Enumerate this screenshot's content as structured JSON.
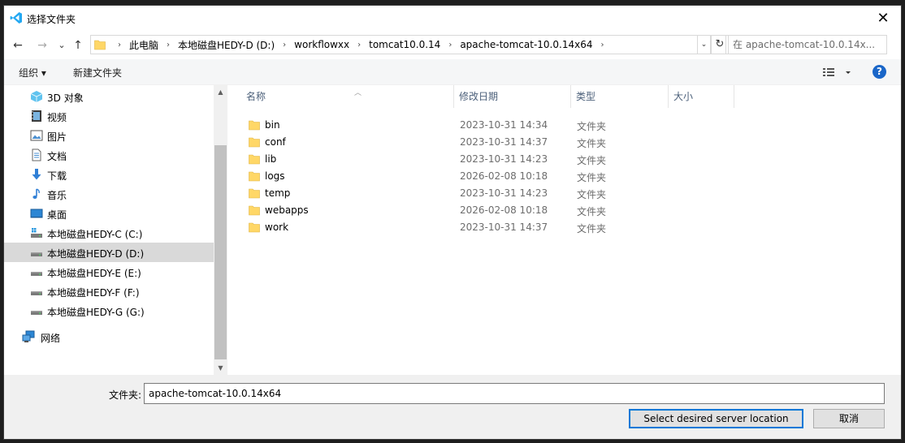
{
  "window": {
    "title": "选择文件夹",
    "close_glyph": "✕"
  },
  "nav": {
    "back": "←",
    "forward": "→",
    "recent": "⌄",
    "up": "↑"
  },
  "address": {
    "crumbs": [
      "此电脑",
      "本地磁盘HEDY-D (D:)",
      "workflowxx",
      "tomcat10.0.14",
      "apache-tomcat-10.0.14x64"
    ],
    "separator": "›",
    "dropdown_glyph": "⌄",
    "refresh_glyph": "↻"
  },
  "search": {
    "placeholder": "在 apache-tomcat-10.0.14x..."
  },
  "commands": {
    "organize": "组织 ▾",
    "new_folder": "新建文件夹",
    "help": "?"
  },
  "sidebar": {
    "items": [
      {
        "label": "3D 对象",
        "icon": "3d-objects-icon"
      },
      {
        "label": "视频",
        "icon": "video-icon"
      },
      {
        "label": "图片",
        "icon": "pictures-icon"
      },
      {
        "label": "文档",
        "icon": "documents-icon"
      },
      {
        "label": "下载",
        "icon": "download-icon"
      },
      {
        "label": "音乐",
        "icon": "music-icon"
      },
      {
        "label": "桌面",
        "icon": "desktop-icon"
      },
      {
        "label": "本地磁盘HEDY-C (C:)",
        "icon": "system-drive-icon"
      },
      {
        "label": "本地磁盘HEDY-D (D:)",
        "icon": "drive-icon",
        "selected": true
      },
      {
        "label": "本地磁盘HEDY-E (E:)",
        "icon": "drive-icon"
      },
      {
        "label": "本地磁盘HEDY-F (F:)",
        "icon": "drive-icon"
      },
      {
        "label": "本地磁盘HEDY-G (G:)",
        "icon": "drive-icon"
      },
      {
        "label": "网络",
        "icon": "network-icon"
      }
    ]
  },
  "columns": {
    "name": "名称",
    "modified": "修改日期",
    "type": "类型",
    "size": "大小"
  },
  "files": [
    {
      "name": "bin",
      "modified": "2023-10-31 14:34",
      "type": "文件夹"
    },
    {
      "name": "conf",
      "modified": "2023-10-31 14:37",
      "type": "文件夹"
    },
    {
      "name": "lib",
      "modified": "2023-10-31 14:23",
      "type": "文件夹"
    },
    {
      "name": "logs",
      "modified": "2026-02-08 10:18",
      "type": "文件夹"
    },
    {
      "name": "temp",
      "modified": "2023-10-31 14:23",
      "type": "文件夹"
    },
    {
      "name": "webapps",
      "modified": "2026-02-08 10:18",
      "type": "文件夹"
    },
    {
      "name": "work",
      "modified": "2023-10-31 14:37",
      "type": "文件夹"
    }
  ],
  "footer": {
    "folder_label": "文件夹:",
    "folder_value": "apache-tomcat-10.0.14x64",
    "confirm": "Select desired server location",
    "cancel": "取消"
  },
  "colors": {
    "accent": "#0078d7",
    "folder": "#ffd767",
    "selected_bg": "#d9d9d9",
    "vscode_blue": "#23a8f2"
  }
}
